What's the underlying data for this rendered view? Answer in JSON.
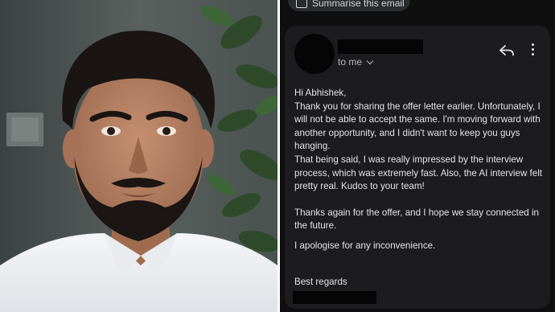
{
  "toolbar": {
    "summarise_label": "Summarise this email",
    "summarise_icon": "summary-icon"
  },
  "email": {
    "recipient_label": "to me",
    "icons": {
      "reply": "reply-icon",
      "more": "more-vert-icon",
      "expand": "chevron-down-icon"
    },
    "greeting": "Hi Abhishek,",
    "paragraph1": "Thank you for sharing the offer letter earlier. Unfortunately, I will not be able to accept the same. I'm moving forward with another opportunity, and I didn't want to keep you guys hanging.",
    "paragraph2": "That being said, I was really impressed by the interview process, which was extremely fast. Also, the AI interview felt pretty real. Kudos to your team!",
    "paragraph3": "Thanks again for the offer, and I hope we stay connected in the future.",
    "paragraph4": "I apologise for any inconvenience.",
    "signoff": "Best regards"
  },
  "colors": {
    "email_background": "#0f0f10",
    "card_background": "#1c1c1f",
    "text_primary": "#e4e4e6",
    "text_secondary": "#b8b9bc",
    "redaction": "#050505"
  }
}
